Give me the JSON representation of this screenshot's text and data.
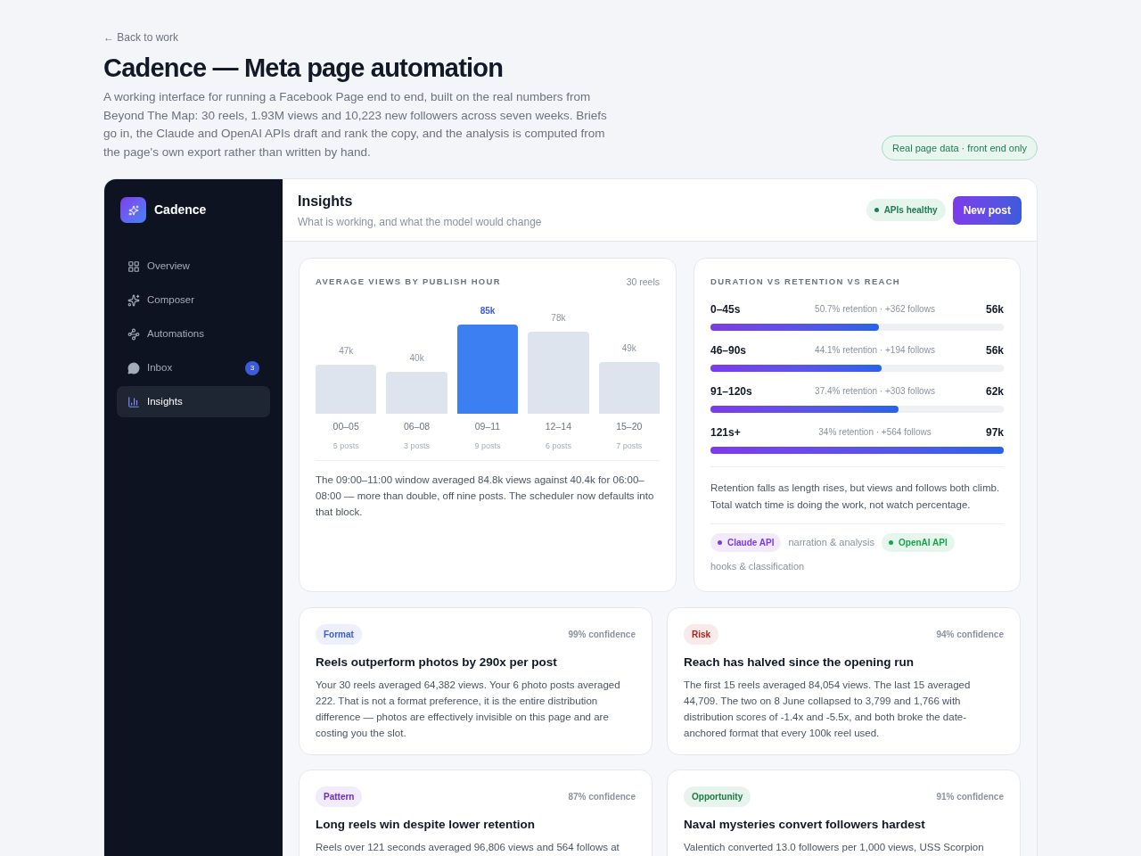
{
  "back_link": "← Back to work",
  "title": "Cadence — Meta page automation",
  "intro": "A working interface for running a Facebook Page end to end, built on the real numbers from Beyond The Map: 30 reels, 1.93M views and 10,223 new followers across seven weeks. Briefs go in, the Claude and OpenAI APIs draft and rank the copy, and the analysis is computed from the page's own export rather than written by hand.",
  "data_pill": "Real page data · front end only",
  "sidebar": {
    "brand": "Cadence",
    "items": [
      {
        "label": "Overview",
        "selected": false
      },
      {
        "label": "Composer",
        "selected": false
      },
      {
        "label": "Automations",
        "selected": false
      },
      {
        "label": "Inbox",
        "selected": false,
        "badge": "3"
      },
      {
        "label": "Insights",
        "selected": true
      }
    ]
  },
  "header": {
    "title": "Insights",
    "subtitle": "What is working, and what the model would change",
    "status": "APIs healthy",
    "button": "New post"
  },
  "hour_chart": {
    "title": "AVERAGE VIEWS BY PUBLISH HOUR",
    "count": "30 reels",
    "bars": [
      {
        "posts": "5 posts"
      },
      {
        "posts": "3 posts"
      },
      {
        "posts": "9 posts"
      },
      {
        "posts": "6 posts"
      },
      {
        "posts": "7 posts"
      }
    ],
    "chart_data": {
      "type": "bar",
      "categories": [
        "00–05",
        "06–08",
        "09–11",
        "12–14",
        "15–20"
      ],
      "series": [
        {
          "color": "#dde4ee",
          "values": [
            47000,
            40000,
            null,
            78000,
            49000
          ],
          "value_labels": [
            "47k",
            "40k",
            null,
            "78k",
            "49k"
          ]
        },
        {
          "color": "#3b7ff2",
          "values": [
            null,
            null,
            85000,
            null,
            null
          ],
          "value_labels": [
            null,
            null,
            "85k",
            null,
            null
          ]
        }
      ]
    },
    "note": "The 09:00–11:00 window averaged 84.8k views against 40.4k for 06:00–08:00 — more than double, off nine posts. The scheduler now defaults into that block."
  },
  "duration_card": {
    "title": "DURATION VS RETENTION VS REACH",
    "rows": [
      {
        "label": "0–45s",
        "detail": "50.7% retention · +362 follows",
        "value": "56k",
        "level": 0.575
      },
      {
        "label": "46–90s",
        "detail": "44.1% retention · +194 follows",
        "value": "56k",
        "level": 0.583
      },
      {
        "label": "91–120s",
        "detail": "37.4% retention · +303 follows",
        "value": "62k",
        "level": 0.642
      },
      {
        "label": "121s+",
        "detail": "34% retention · +564 follows",
        "value": "97k",
        "level": 1
      }
    ],
    "note": "Retention falls as length rises, but views and follows both climb. Total watch time is doing the work, not watch percentage.",
    "apis": [
      {
        "name": "Claude API",
        "color": "#7c3aed",
        "role": "narration & analysis"
      },
      {
        "name": "OpenAI API",
        "color": "#16a34a",
        "role": "hooks & classification"
      }
    ]
  },
  "insights": [
    {
      "tag": "Format",
      "color": "#3b5bdb",
      "confidence": "99% confidence",
      "title": "Reels outperform photos by 290x per post",
      "body": "Your 30 reels averaged 64,382 views. Your 6 photo posts averaged 222. That is not a format preference, it is the entire distribution difference — photos are effectively invisible on this page and are costing you the slot."
    },
    {
      "tag": "Risk",
      "color": "#b91c1c",
      "confidence": "94% confidence",
      "title": "Reach has halved since the opening run",
      "body": "The first 15 reels averaged 84,054 views. The last 15 averaged 44,709. The two on 8 June collapsed to 3,799 and 1,766 with distribution scores of -1.4x and -5.5x, and both broke the date-anchored format that every 100k reel used."
    },
    {
      "tag": "Pattern",
      "color": "#6d28d9",
      "confidence": "87% confidence",
      "title": "Long reels win despite lower retention",
      "body": "Reels over 121 seconds averaged 96,806 views and 564 follows at"
    },
    {
      "tag": "Opportunity",
      "color": "#15803d",
      "confidence": "91% confidence",
      "title": "Naval mysteries convert followers hardest",
      "body": "Valentich converted 13.0 followers per 1,000 views, USS Scorpion"
    }
  ]
}
